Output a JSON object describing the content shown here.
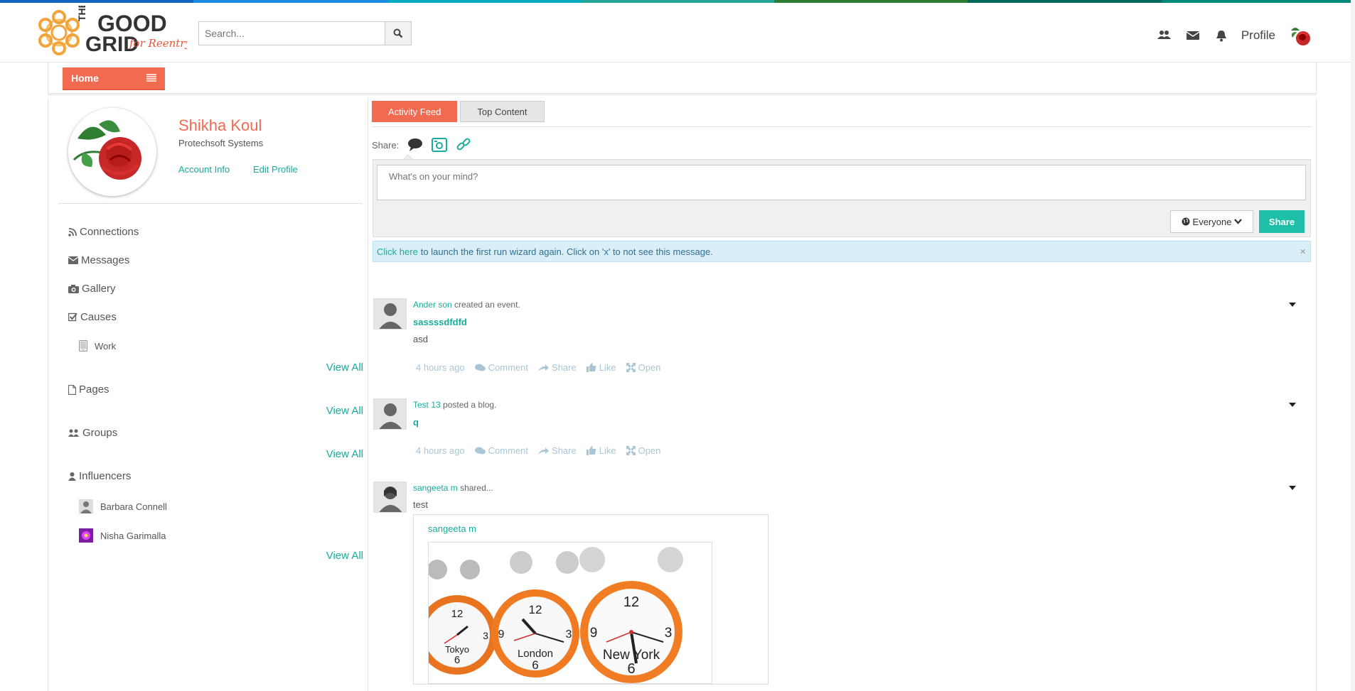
{
  "header": {
    "logo": {
      "line1": "THE",
      "line2": "GOOD",
      "line3": "GRID",
      "tagline": "for Reentry"
    },
    "search": {
      "placeholder": "Search..."
    },
    "profile_label": "Profile",
    "stripe_colors": [
      "#1565c0",
      "#1e88e5",
      "#00acc1",
      "#26a69a",
      "#2e7d32",
      "#00695c",
      "#00897b"
    ]
  },
  "subbar": {
    "home_label": "Home"
  },
  "user": {
    "name": "Shikha Koul",
    "org": "Protechsoft Systems",
    "account_info": "Account Info",
    "edit_profile": "Edit Profile"
  },
  "sidebar": {
    "connections": "Connections",
    "messages": "Messages",
    "gallery": "Gallery",
    "causes": "Causes",
    "causes_items": [
      "Work"
    ],
    "pages": "Pages",
    "groups": "Groups",
    "influencers": "Influencers",
    "influencer_items": [
      "Barbara Connell",
      "Nisha Garimalla"
    ],
    "view_all": "View All"
  },
  "main": {
    "tabs": [
      "Activity Feed",
      "Top Content"
    ],
    "share_label": "Share:",
    "composer_placeholder": "What's on your mind?",
    "audience": "Everyone",
    "share_button": "Share",
    "alert_link": "Click here",
    "alert_text": "to launch the first run wizard again. Click on 'x' to not see this message.",
    "alert_close": "×"
  },
  "feed": [
    {
      "author": "Ander son",
      "action": "created an event.",
      "title": "sassssdfdfd",
      "body": "asd",
      "time": "4 hours ago"
    },
    {
      "author": "Test 13",
      "action": "posted a blog.",
      "title": "q",
      "body": "",
      "time": "4 hours ago"
    },
    {
      "author": "sangeeta m",
      "action": "shared...",
      "title": "",
      "body": "test",
      "time": "",
      "shared_author": "sangeeta m",
      "clock_labels": [
        "Tokyo",
        "London",
        "New York"
      ]
    }
  ],
  "actions": {
    "comment": "Comment",
    "share": "Share",
    "like": "Like",
    "open": "Open"
  },
  "colors": {
    "accent": "#f26a50",
    "teal": "#1aab9b",
    "share_btn": "#1ebfa8"
  }
}
